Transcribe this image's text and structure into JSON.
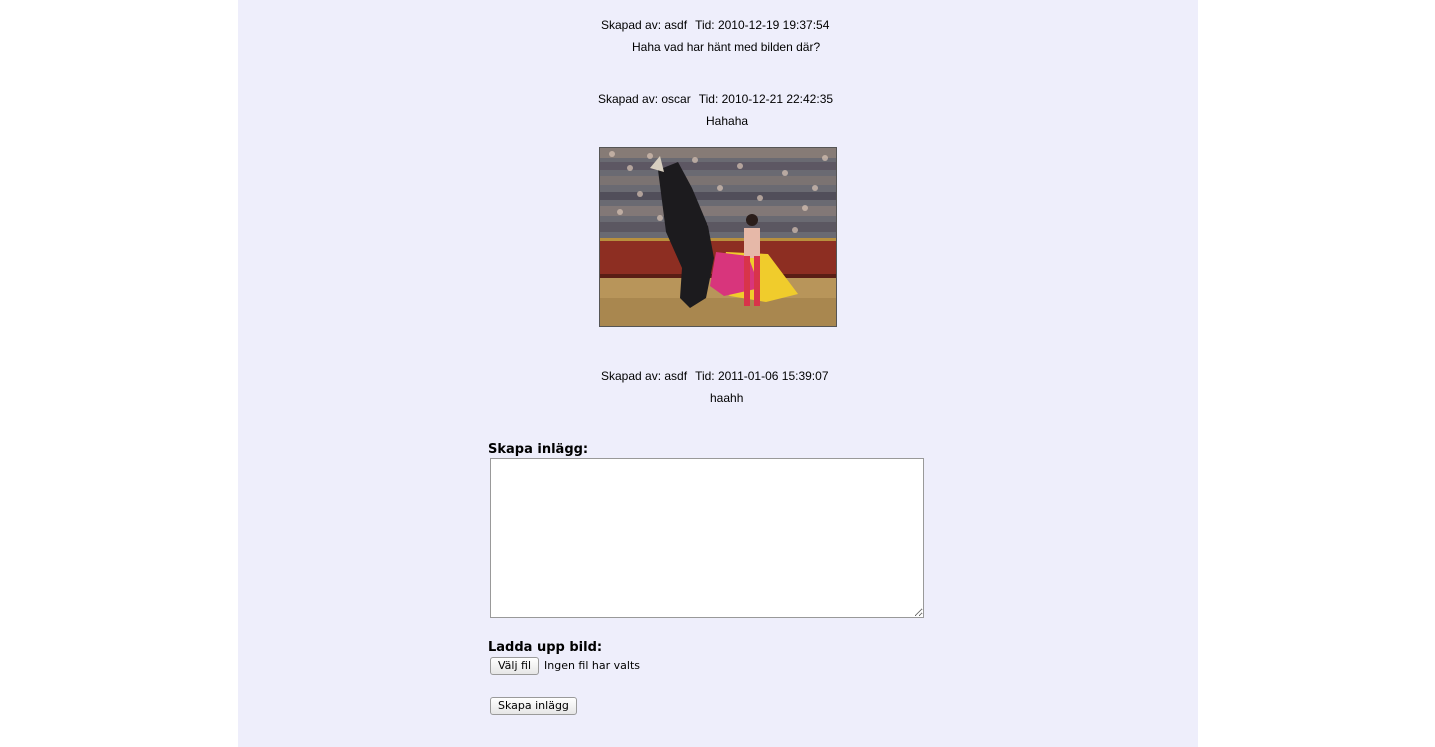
{
  "posts": [
    {
      "author_label": "Skapad av: asdf",
      "time_label": "Tid: 2010-12-19 19:37:54",
      "message": "Haha vad har hänt med bilden där?"
    },
    {
      "author_label": "Skapad av: oscar",
      "time_label": "Tid: 2010-12-21 22:42:35",
      "message": "Hahaha",
      "image": "bullfight-photo"
    },
    {
      "author_label": "Skapad av: asdf",
      "time_label": "Tid: 2011-01-06 15:39:07",
      "message": "haahh"
    }
  ],
  "form": {
    "create_label": "Skapa inlägg:",
    "textarea_value": "",
    "upload_label": "Ladda upp bild:",
    "choose_file_button": "Välj fil",
    "no_file_text": "Ingen fil har valts",
    "submit_button": "Skapa inlägg"
  },
  "colors": {
    "page_background": "#eeeefb",
    "outer_background": "#ffffff"
  }
}
